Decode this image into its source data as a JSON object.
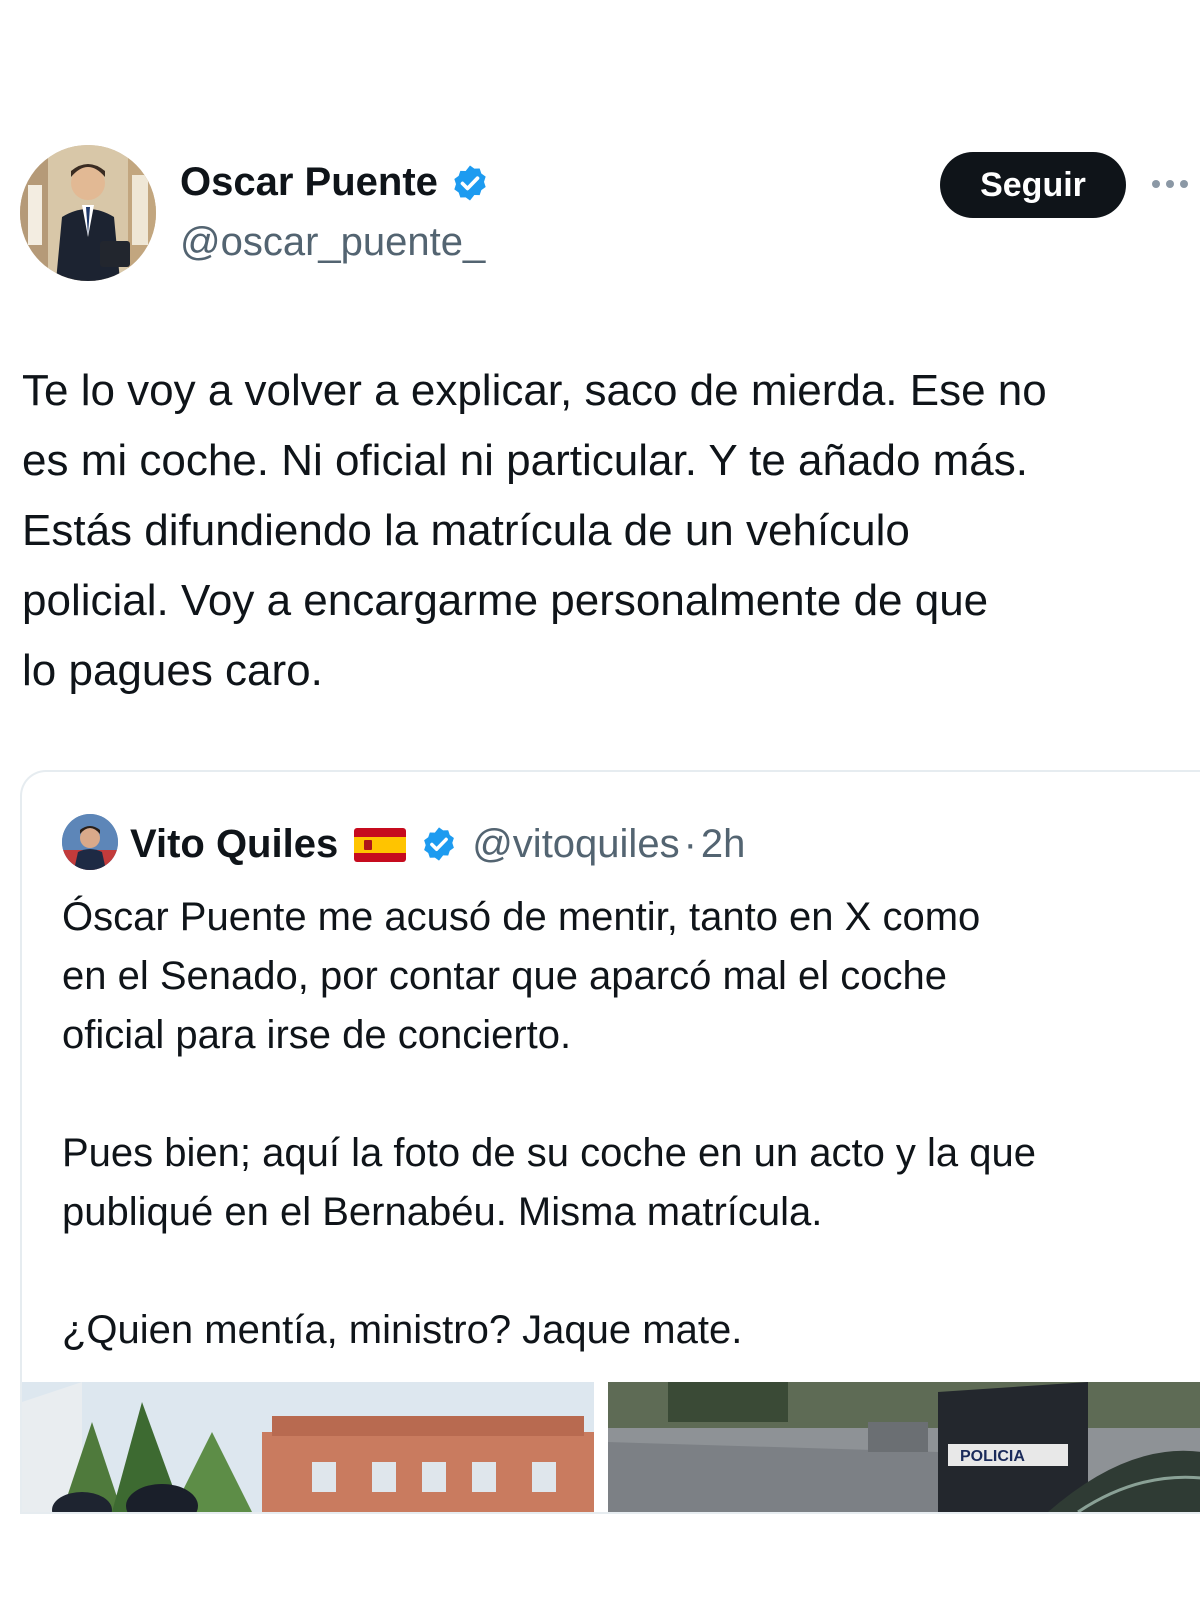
{
  "tweet": {
    "author": {
      "name": "Oscar Puente",
      "handle": "@oscar_puente_",
      "verified": true
    },
    "follow_label": "Seguir",
    "text_lines": [
      "Te lo voy a volver a explicar, saco de mierda. Ese no",
      "es mi coche. Ni oficial ni particular. Y te añado más.",
      "Estás difundiendo la matrícula de un vehículo",
      "policial. Voy a encargarme personalmente de que",
      "lo pagues caro."
    ]
  },
  "quoted_tweet": {
    "author": {
      "name": "Vito Quiles",
      "handle": "@vitoquiles",
      "verified": true
    },
    "separator": "·",
    "time": "2h",
    "paragraphs": [
      [
        "Óscar Puente me acusó de mentir, tanto en X como",
        "en el Senado, por contar que aparcó mal el coche",
        "oficial para irse de concierto."
      ],
      [
        "Pues bien; aquí la foto de su coche en un acto y la que",
        "publiqué en el Bernabéu. Misma matrícula."
      ],
      [
        "¿Quien mentía, ministro? Jaque mate."
      ]
    ],
    "media": [
      {
        "description": "photo-building"
      },
      {
        "description": "photo-street-police-van",
        "visible_text": "POLICIA"
      }
    ]
  },
  "colors": {
    "text": "#0f1419",
    "secondary": "#536471",
    "verified_blue": "#1d9bf0",
    "follow_bg": "#0f1419",
    "border": "#e6ecf0"
  }
}
